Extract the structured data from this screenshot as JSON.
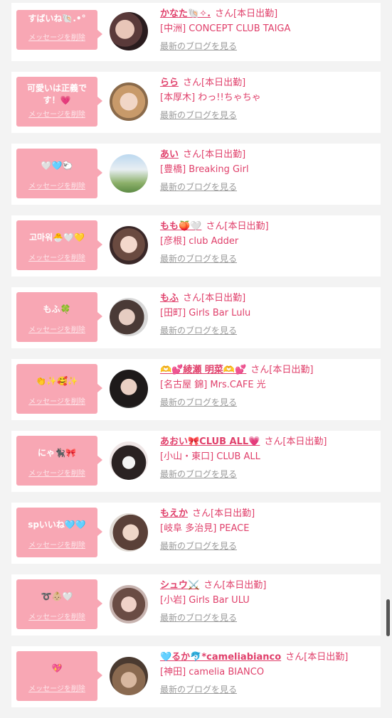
{
  "colors": {
    "accent": "#e0406b",
    "message_bg": "#f8a7b4",
    "background": "#f3f3f3"
  },
  "delete_label": "メッセージを削除",
  "blog_label": "最新のブログを見る",
  "cards": [
    {
      "message": "すばいね🐚.•°",
      "name": "かなた🐚✧.",
      "san": "さん[本日出勤]",
      "shop": "[中洲] CONCEPT CLUB TAIGA",
      "avatar": "avatar-photo"
    },
    {
      "message": "可愛いは正義です！💗",
      "name": "らら",
      "san": "さん[本日出勤]",
      "shop": "[本厚木] わっ!!ちゃちゃ",
      "avatar": "avatar-photo"
    },
    {
      "message": "🤍🩵🐑",
      "name": "あい",
      "san": "さん[本日出勤]",
      "shop": "[豊橋] Breaking Girl",
      "avatar": "avatar-photo"
    },
    {
      "message": "고마워🐣🤍💛",
      "name": "もも🍑🤍",
      "san": "さん[本日出勤]",
      "shop": "[彦根] club Adder",
      "avatar": "avatar-photo"
    },
    {
      "message": "もふ🍀",
      "name": "もふ",
      "san": "さん[本日出勤]",
      "shop": "[田町] Girls Bar Lulu",
      "avatar": "avatar-photo"
    },
    {
      "message": "👏✨🥰✨",
      "name": "🫶💕綾瀬 明菜🫶💕",
      "san": "さん[本日出勤]",
      "shop": "[名古屋 錦] Mrs.CAFE 光",
      "avatar": "avatar-photo"
    },
    {
      "message": "にゃ🐈‍⬛🎀",
      "name": "あおい🎀CLUB ALL💗",
      "san": "さん[本日出勤]",
      "shop": "[小山・東口] CLUB ALL",
      "avatar": "avatar-photo"
    },
    {
      "message": "spいいね🩵🩵",
      "name": "もえか",
      "san": "さん[本日出勤]",
      "shop": "[岐阜 多治見] PEACE",
      "avatar": "avatar-photo"
    },
    {
      "message": "➰👶🏼🤍",
      "name": "シュウ⚔️",
      "san": "さん[本日出勤]",
      "shop": "[小岩] Girls Bar ULU",
      "avatar": "avatar-photo"
    },
    {
      "message": "💖",
      "name": "🩵るか🐬*cameliabianco",
      "san": "さん[本日出勤]",
      "shop": "[神田] camelia BIANCO",
      "avatar": "avatar-photo"
    }
  ]
}
